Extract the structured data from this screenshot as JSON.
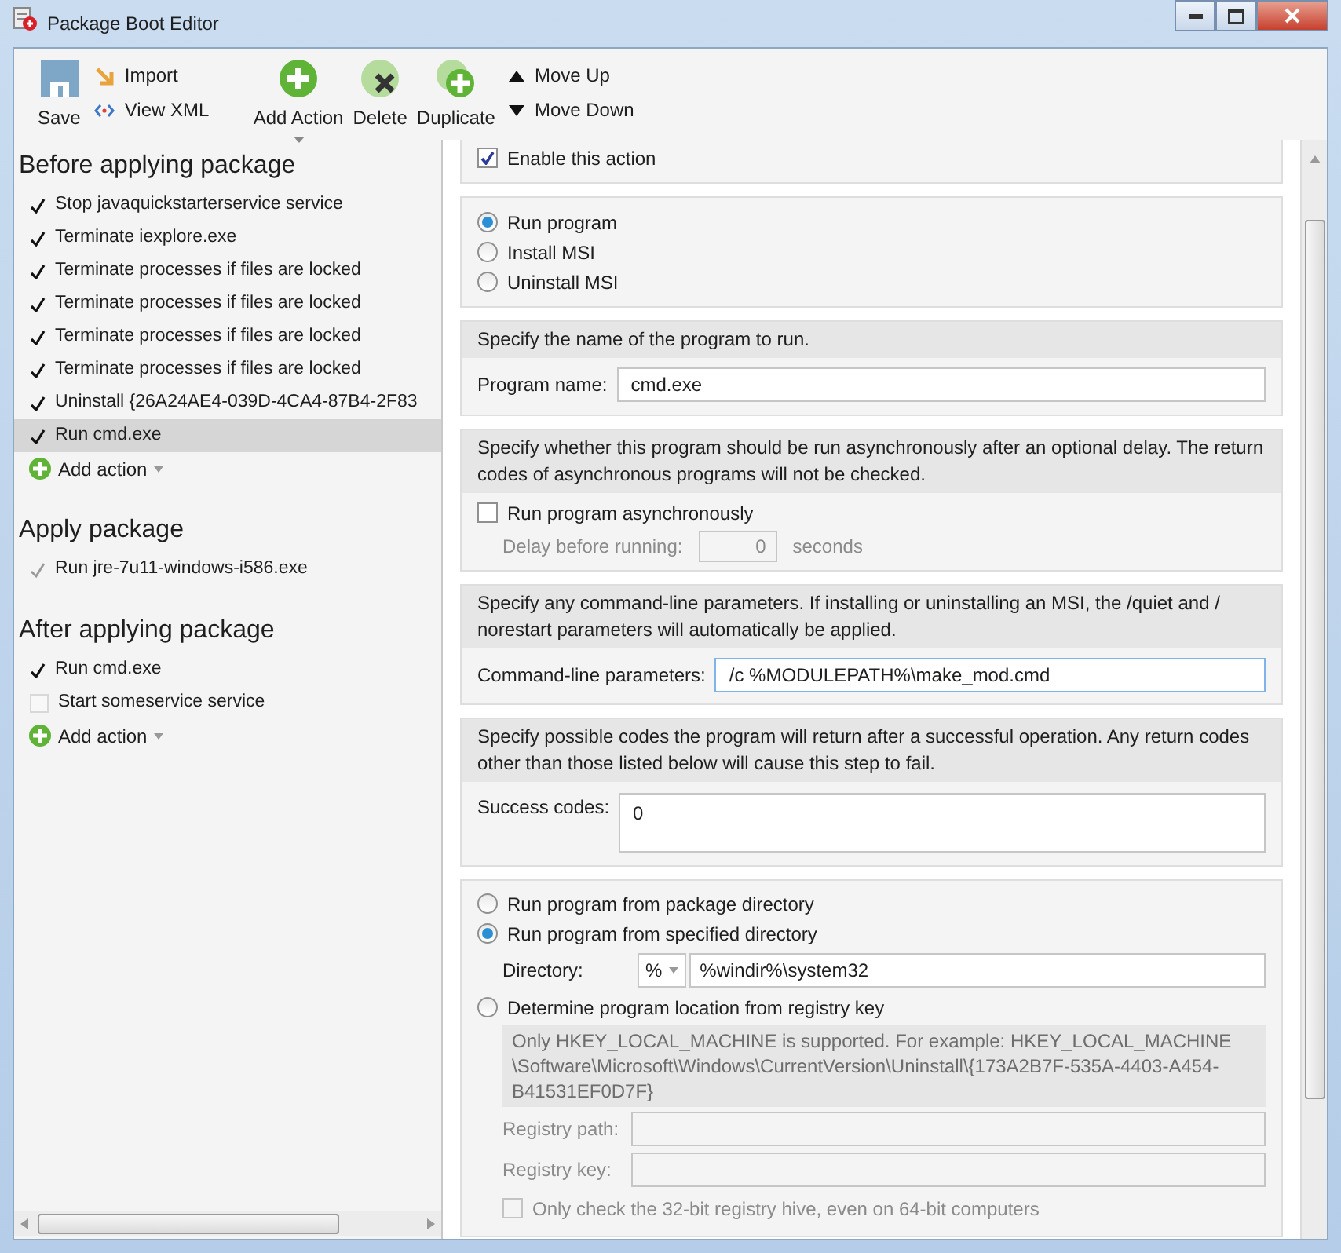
{
  "window": {
    "title": "Package Boot Editor"
  },
  "toolbar": {
    "save": "Save",
    "import": "Import",
    "view_xml": "View XML",
    "add_action": "Add Action",
    "delete": "Delete",
    "duplicate": "Duplicate",
    "move_up": "Move Up",
    "move_down": "Move Down"
  },
  "sidebar": {
    "groups": [
      {
        "title": "Before applying package",
        "add_action": "Add action",
        "items": [
          {
            "label": "Stop javaquickstarterservice service",
            "kind": "checked",
            "selected": false
          },
          {
            "label": "Terminate iexplore.exe",
            "kind": "checked",
            "selected": false
          },
          {
            "label": "Terminate processes if files are locked",
            "kind": "checked",
            "selected": false
          },
          {
            "label": "Terminate processes if files are locked",
            "kind": "checked",
            "selected": false
          },
          {
            "label": "Terminate processes if files are locked",
            "kind": "checked",
            "selected": false
          },
          {
            "label": "Terminate processes if files are locked",
            "kind": "checked",
            "selected": false
          },
          {
            "label": "Uninstall {26A24AE4-039D-4CA4-87B4-2F83",
            "kind": "checked",
            "selected": false
          },
          {
            "label": "Run cmd.exe",
            "kind": "checked",
            "selected": true
          }
        ]
      },
      {
        "title": "Apply package",
        "items": [
          {
            "label": "Run jre-7u11-windows-i586.exe",
            "kind": "greyed",
            "selected": false
          }
        ]
      },
      {
        "title": "After applying package",
        "add_action": "Add action",
        "items": [
          {
            "label": "Run cmd.exe",
            "kind": "checked",
            "selected": false
          },
          {
            "label": "Start someservice service",
            "kind": "unchecked",
            "selected": false
          }
        ]
      }
    ]
  },
  "editor": {
    "enable": {
      "label": "Enable this action",
      "checked": true
    },
    "action_types": [
      {
        "label": "Run program",
        "selected": true
      },
      {
        "label": "Install MSI",
        "selected": false
      },
      {
        "label": "Uninstall MSI",
        "selected": false
      }
    ],
    "program": {
      "heading": "Specify the name of the program to run.",
      "label": "Program name:",
      "value": "cmd.exe"
    },
    "async": {
      "heading": "Specify whether this program should be run asynchronously after an optional delay. The return codes of asynchronous programs will not be checked.",
      "checkbox": {
        "label": "Run program asynchronously",
        "checked": false
      },
      "delay_label": "Delay before running:",
      "delay_value": "0",
      "delay_unit": "seconds"
    },
    "params": {
      "heading": "Specify any command-line parameters. If installing or uninstalling an MSI, the /quiet and / norestart parameters will automatically be applied.",
      "label": "Command-line parameters:",
      "value": "/c %MODULEPATH%\\make_mod.cmd"
    },
    "codes": {
      "heading": "Specify possible codes the program will return after a successful operation. Any return codes other than those listed below will cause this step to fail.",
      "label": "Success codes:",
      "value": "0"
    },
    "location": {
      "options": [
        {
          "label": "Run program from package directory",
          "selected": false
        },
        {
          "label": "Run program from specified directory",
          "selected": true
        },
        {
          "label": "Determine program location from registry key",
          "selected": false
        }
      ],
      "directory_label": "Directory:",
      "directory_prefix": "%",
      "directory_value": "%windir%\\system32",
      "registry_note": "Only HKEY_LOCAL_MACHINE is supported. For example: HKEY_LOCAL_MACHINE \\Software\\Microsoft\\Windows\\CurrentVersion\\Uninstall\\{173A2B7F-535A-4403-A454-B41531EF0D7F}",
      "registry_path_label": "Registry path:",
      "registry_key_label": "Registry key:",
      "hive_checkbox": {
        "label": "Only check the 32-bit registry hive, even on 64-bit computers",
        "checked": false
      }
    }
  }
}
